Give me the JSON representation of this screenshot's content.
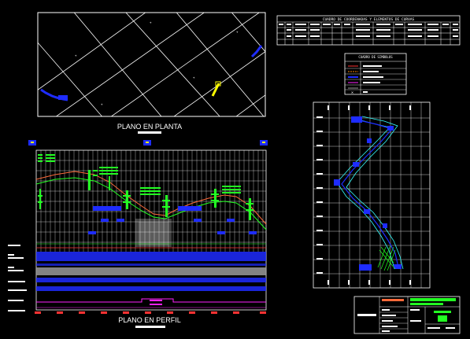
{
  "plan_view": {
    "title": "PLANO EN PLANTA"
  },
  "profile_view": {
    "title": "PLANO EN PERFIL",
    "row_labels": [
      "",
      "",
      "",
      "",
      "",
      "",
      "",
      "",
      "",
      ""
    ],
    "stations": [
      "",
      "",
      "",
      "",
      "",
      "",
      "",
      "",
      "",
      "",
      ""
    ],
    "center_tag": ""
  },
  "curve_table": {
    "title": "CUADRO DE COORDENADAS Y ELEMENTOS DE CURVAS"
  },
  "symbol_table": {
    "title": "CUADRO DE SIMBOLOS"
  },
  "title_block": {
    "left_label": ""
  },
  "colors": {
    "grid": "#ffffff",
    "blue": "#1e2cff",
    "green": "#22ff22",
    "yellow": "#ffff00",
    "magenta": "#ff22ff",
    "red": "#ff3333",
    "cyan": "#33ffff",
    "orange": "#ff8800"
  }
}
